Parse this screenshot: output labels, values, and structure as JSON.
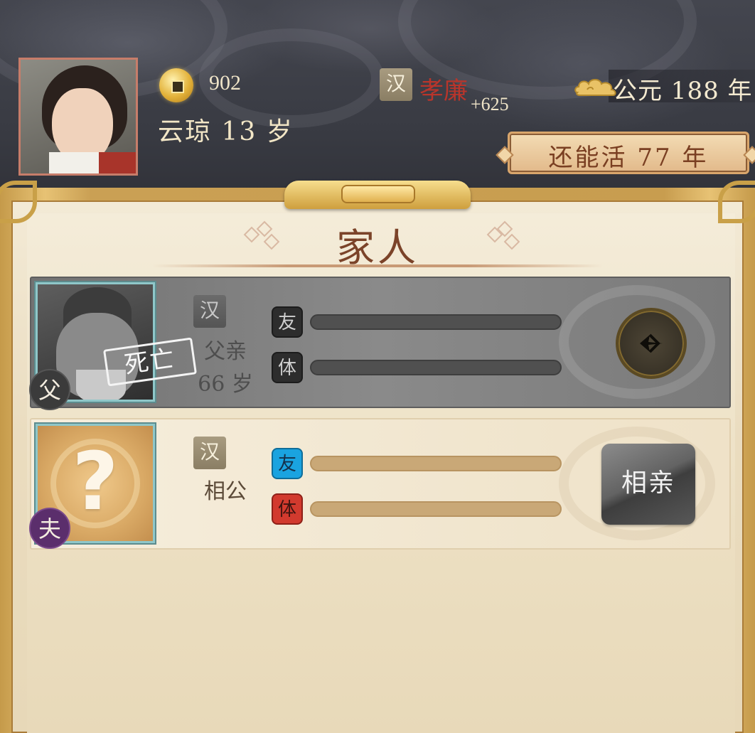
{
  "header": {
    "player": {
      "name_age": "云琼 13 岁",
      "gender_symbol": "♀"
    },
    "coins": {
      "icon": "coin-icon",
      "amount": "902"
    },
    "nation": {
      "tag": "汉",
      "title": "孝廉",
      "bonus": "+625"
    },
    "date": {
      "icon": "cloud-icon",
      "text": "公元 188 年"
    },
    "lifespan": {
      "text": "还能活 77 年"
    }
  },
  "section": {
    "title": "家人"
  },
  "family": [
    {
      "relation_badge": "父",
      "nation_tag": "汉",
      "role": "父亲",
      "age": "66 岁",
      "status": "死亡",
      "stats": [
        {
          "label": "友",
          "value": 0
        },
        {
          "label": "体",
          "value": 0
        }
      ],
      "action": {
        "icon": "go-arrow-icon"
      }
    },
    {
      "relation_badge": "夫",
      "nation_tag": "汉",
      "role": "相公",
      "portrait": "?",
      "stats": [
        {
          "label": "友",
          "value": 0
        },
        {
          "label": "体",
          "value": 0
        }
      ],
      "action": {
        "label": "相亲"
      }
    }
  ],
  "colors": {
    "accent_gold": "#c9a048",
    "title_red": "#b9352b",
    "panel_bg": "#f0e5cd",
    "friend_blue": "#1aa3e0",
    "health_red": "#d23a2e"
  }
}
